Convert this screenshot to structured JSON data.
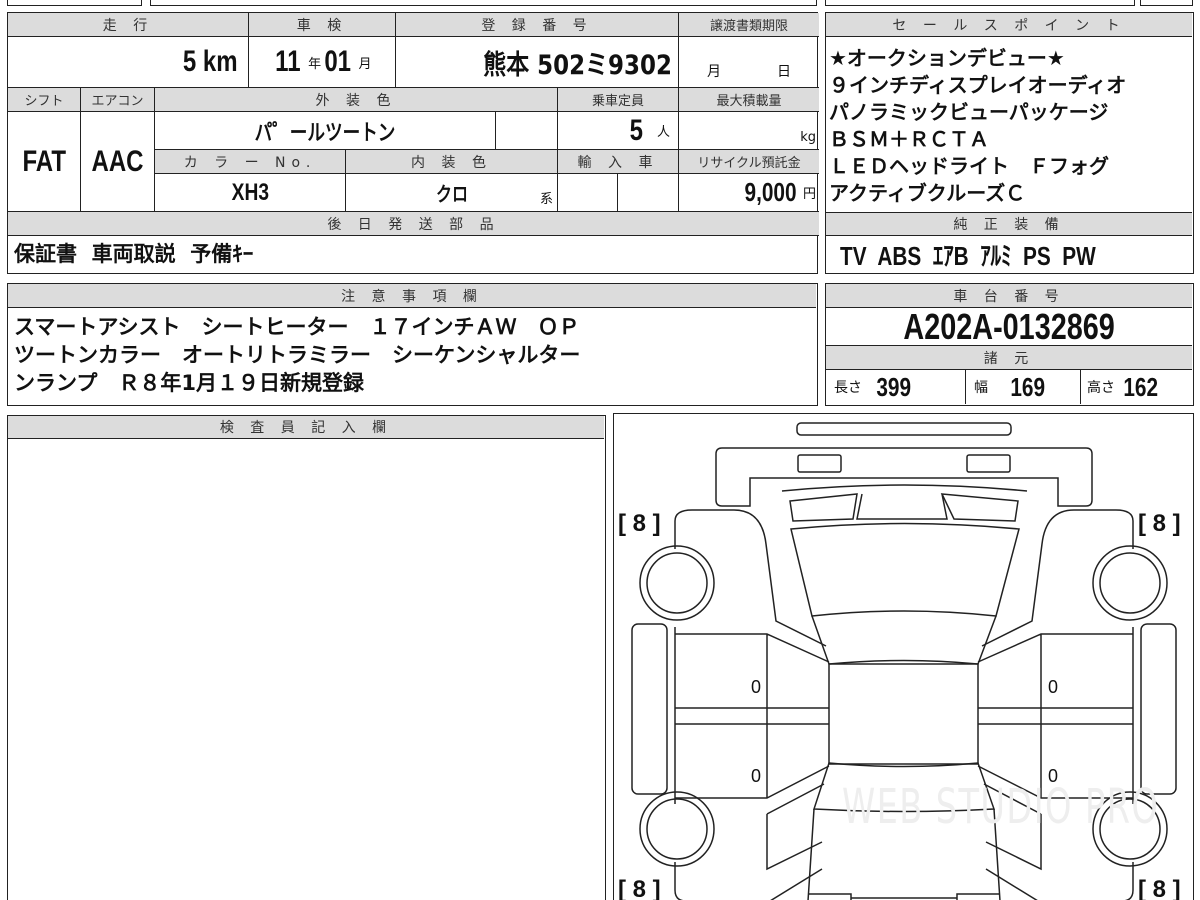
{
  "summary": {
    "mileage_header": "走 行",
    "mileage_value": "5",
    "mileage_unit": "km",
    "inspection_header": "車 検",
    "inspection_year": "11",
    "year_unit": "年",
    "inspection_month": "01",
    "month_unit": "月",
    "registration_header": "登 録 番 号",
    "registration_value": "熊本 502ミ9302",
    "transfer_deadline_header": "譲渡書類期限",
    "transfer_month_unit": "月",
    "transfer_day_unit": "日",
    "shift_header": "シフト",
    "shift_value": "FAT",
    "ac_header": "エアコン",
    "ac_value": "AAC",
    "exterior_color_header": "外 装 色",
    "exterior_color_value": "パ゜ールツートン",
    "capacity_header": "乗車定員",
    "capacity_value": "5",
    "capacity_unit": "人",
    "max_load_header": "最大積載量",
    "max_load_unit": "kg",
    "color_no_header": "カ ラ ー No.",
    "color_no_value": "XH3",
    "interior_color_header": "内 装 色",
    "interior_color_value": "クロ",
    "interior_color_suffix": "系",
    "import_header": "輸 入 車",
    "recycle_header": "リサイクル預託金",
    "recycle_value": "9,000",
    "recycle_unit": "円",
    "later_parts_header": "後 日 発 送 部 品",
    "later_parts_value": "保証書  車両取説  予備ｷｰ"
  },
  "sales_points": {
    "header": "セ ー ル ス ポ イ ン ト",
    "lines": [
      "★オークションデビュー★",
      "９インチディスプレイオーディオ",
      "パノラミックビューパッケージ",
      "ＢＳＭ＋ＲＣＴＡ",
      "ＬＥＤヘッドライト　Ｆフォグ",
      "アクティブクルーズＣ"
    ]
  },
  "equipment": {
    "header": "純 正 装 備",
    "value": "TV  ABS  ｴｱB  ｱﾙﾐ  PS  PW"
  },
  "notes": {
    "header": "注 意 事 項 欄",
    "lines": [
      "スマートアシスト　シートヒーター　１７インチＡＷ　ＯＰ",
      "ツートンカラー　オートリトラミラー　シーケンシャルター",
      "ンランプ　Ｒ８年1月１９日新規登録"
    ]
  },
  "chassis": {
    "header": "車 台 番 号",
    "value": "A202A-0132869",
    "spec_header": "諸 元",
    "length_label": "長さ",
    "length_value": "399",
    "width_label": "幅",
    "width_value": "169",
    "height_label": "高さ",
    "height_value": "162"
  },
  "inspector": {
    "header": "検 査 員 記 入 欄"
  },
  "diagram": {
    "tire_labels": [
      "[ 8 ]",
      "[ 8 ]",
      "[ 8 ]",
      "[ 8 ]"
    ],
    "door_marks": [
      "0",
      "0",
      "0",
      "0"
    ],
    "watermark": "WEB STUDIO PRO"
  }
}
